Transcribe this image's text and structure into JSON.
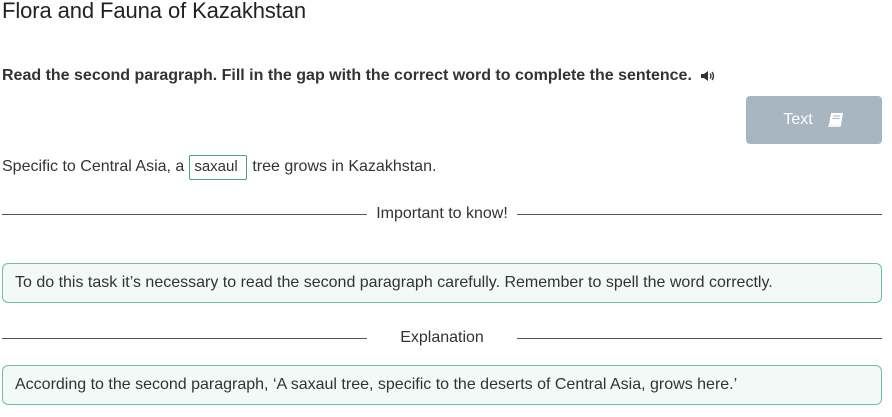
{
  "page": {
    "title": "Flora and Fauna of Kazakhstan"
  },
  "task": {
    "instruction": "Read the second paragraph. Fill in the gap with the correct word to complete the sentence.",
    "audio_icon": "speaker-icon"
  },
  "text_button": {
    "label": "Text",
    "icon": "book-icon",
    "color": "#a8b6c2"
  },
  "sentence": {
    "before": "Specific to Central Asia, a",
    "gap_value": "saxaul",
    "after": "tree grows in Kazakhstan."
  },
  "important": {
    "heading": "Important to know!",
    "text": "To do this task it’s necessary to read the second paragraph carefully. Remember to spell the word correctly."
  },
  "explanation": {
    "heading": "Explanation",
    "text": "According to the second paragraph, ‘A saxaul tree, specific to the deserts of Central Asia, grows here.’"
  },
  "colors": {
    "accent_border": "#6fbfa9",
    "box_background": "#f2f9f7",
    "input_border": "#4aa08a"
  }
}
